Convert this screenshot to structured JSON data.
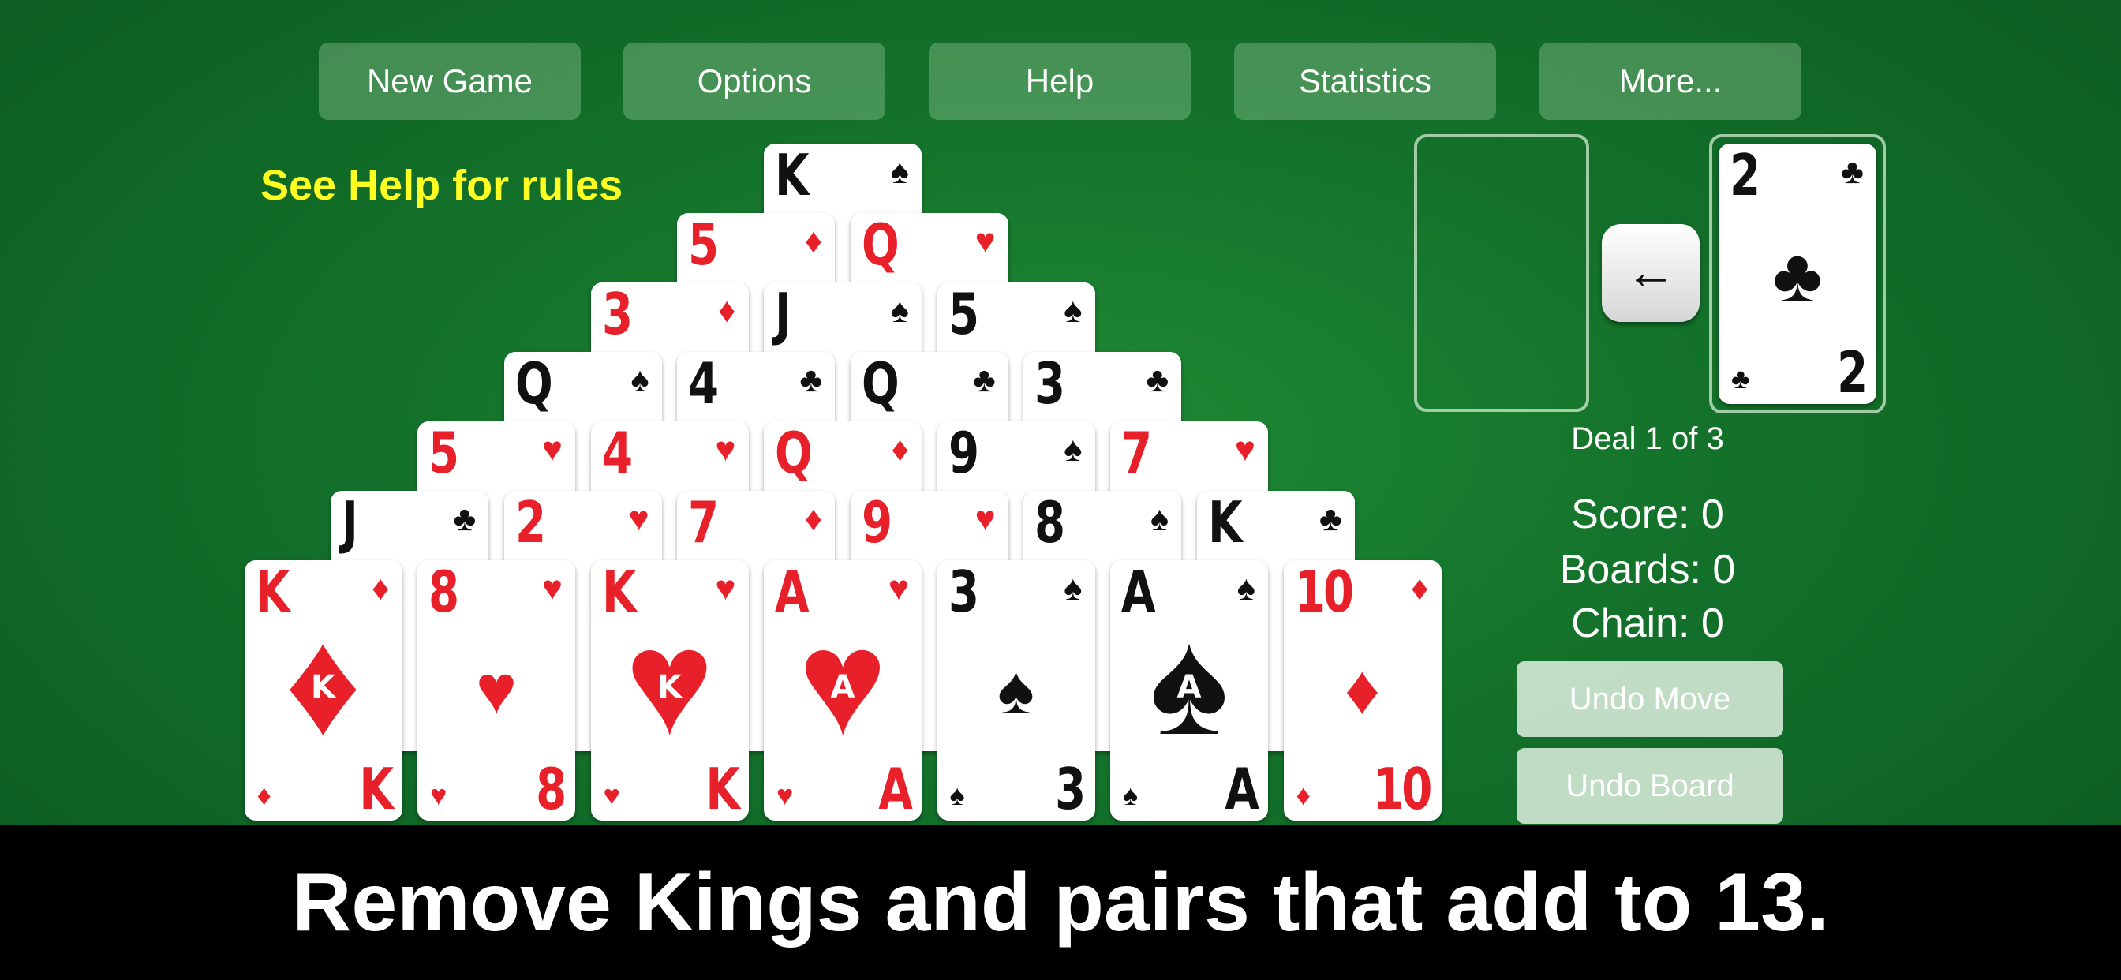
{
  "menu": {
    "new_game": "New Game",
    "options": "Options",
    "help": "Help",
    "statistics": "Statistics",
    "more": "More..."
  },
  "help_note": "See Help for rules",
  "pyramid": [
    [
      {
        "rank": "K",
        "suit": "♠",
        "color": "black"
      }
    ],
    [
      {
        "rank": "5",
        "suit": "♦",
        "color": "red"
      },
      {
        "rank": "Q",
        "suit": "♥",
        "color": "red"
      }
    ],
    [
      {
        "rank": "3",
        "suit": "♦",
        "color": "red"
      },
      {
        "rank": "J",
        "suit": "♠",
        "color": "black"
      },
      {
        "rank": "5",
        "suit": "♠",
        "color": "black"
      }
    ],
    [
      {
        "rank": "Q",
        "suit": "♠",
        "color": "black"
      },
      {
        "rank": "4",
        "suit": "♣",
        "color": "black"
      },
      {
        "rank": "Q",
        "suit": "♣",
        "color": "black"
      },
      {
        "rank": "3",
        "suit": "♣",
        "color": "black"
      }
    ],
    [
      {
        "rank": "5",
        "suit": "♥",
        "color": "red"
      },
      {
        "rank": "4",
        "suit": "♥",
        "color": "red"
      },
      {
        "rank": "Q",
        "suit": "♦",
        "color": "red"
      },
      {
        "rank": "9",
        "suit": "♠",
        "color": "black"
      },
      {
        "rank": "7",
        "suit": "♥",
        "color": "red"
      }
    ],
    [
      {
        "rank": "J",
        "suit": "♣",
        "color": "black"
      },
      {
        "rank": "2",
        "suit": "♥",
        "color": "red"
      },
      {
        "rank": "7",
        "suit": "♦",
        "color": "red"
      },
      {
        "rank": "9",
        "suit": "♥",
        "color": "red"
      },
      {
        "rank": "8",
        "suit": "♠",
        "color": "black"
      },
      {
        "rank": "K",
        "suit": "♣",
        "color": "black"
      }
    ],
    [
      {
        "rank": "K",
        "suit": "♦",
        "color": "red"
      },
      {
        "rank": "8",
        "suit": "♥",
        "color": "red"
      },
      {
        "rank": "K",
        "suit": "♥",
        "color": "red"
      },
      {
        "rank": "A",
        "suit": "♥",
        "color": "red"
      },
      {
        "rank": "3",
        "suit": "♠",
        "color": "black"
      },
      {
        "rank": "A",
        "suit": "♠",
        "color": "black"
      },
      {
        "rank": "10",
        "suit": "♦",
        "color": "red"
      }
    ]
  ],
  "waste_card": {
    "rank": "2",
    "suit": "♣",
    "color": "black"
  },
  "arrow_icon": "←",
  "deal_text": "Deal 1 of 3",
  "score_text": "Score: 0",
  "boards_text": "Boards: 0",
  "chain_text": "Chain: 0",
  "undo_move": "Undo Move",
  "undo_board": "Undo Board",
  "caption": "Remove Kings and pairs that add to 13."
}
